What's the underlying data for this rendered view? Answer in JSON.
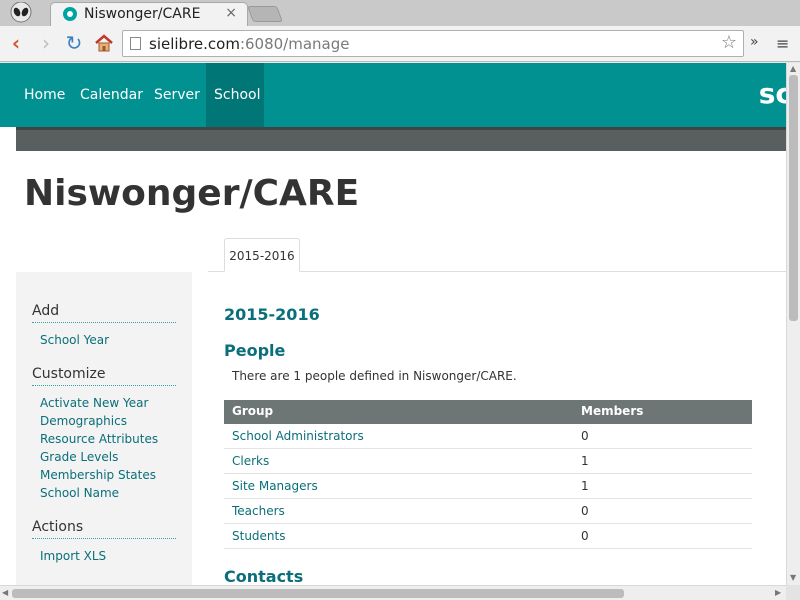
{
  "browser": {
    "tab_title": "Niswonger/CARE",
    "url_domain": "sielibre.com",
    "url_rest": ":6080/manage",
    "tab_close": "×",
    "ext_label": "»",
    "menu_label": "≡"
  },
  "nav": {
    "items": [
      "Home",
      "Calendar",
      "Server",
      "School"
    ],
    "active": "School",
    "brand_partial": "sc"
  },
  "page": {
    "title": "Niswonger/CARE"
  },
  "sidebar": {
    "add_heading": "Add",
    "add_items": [
      "School Year"
    ],
    "customize_heading": "Customize",
    "customize_items": [
      "Activate New Year",
      "Demographics",
      "Resource Attributes",
      "Grade Levels",
      "Membership States",
      "School Name"
    ],
    "actions_heading": "Actions",
    "actions_items": [
      "Import XLS"
    ]
  },
  "tabs": {
    "year_tab": "2015-2016"
  },
  "content": {
    "year_heading": "2015-2016",
    "people_heading": "People",
    "people_text": "There are 1 people defined in Niswonger/CARE.",
    "contacts_heading": "Contacts",
    "table": {
      "headers": [
        "Group",
        "Members"
      ],
      "rows": [
        {
          "group": "School Administrators",
          "members": "0"
        },
        {
          "group": "Clerks",
          "members": "1"
        },
        {
          "group": "Site Managers",
          "members": "1"
        },
        {
          "group": "Teachers",
          "members": "0"
        },
        {
          "group": "Students",
          "members": "0"
        }
      ]
    }
  },
  "colors": {
    "nav_bg": "#019191",
    "nav_active": "#017676",
    "link": "#0a6f7a",
    "table_header": "#6e7675"
  }
}
